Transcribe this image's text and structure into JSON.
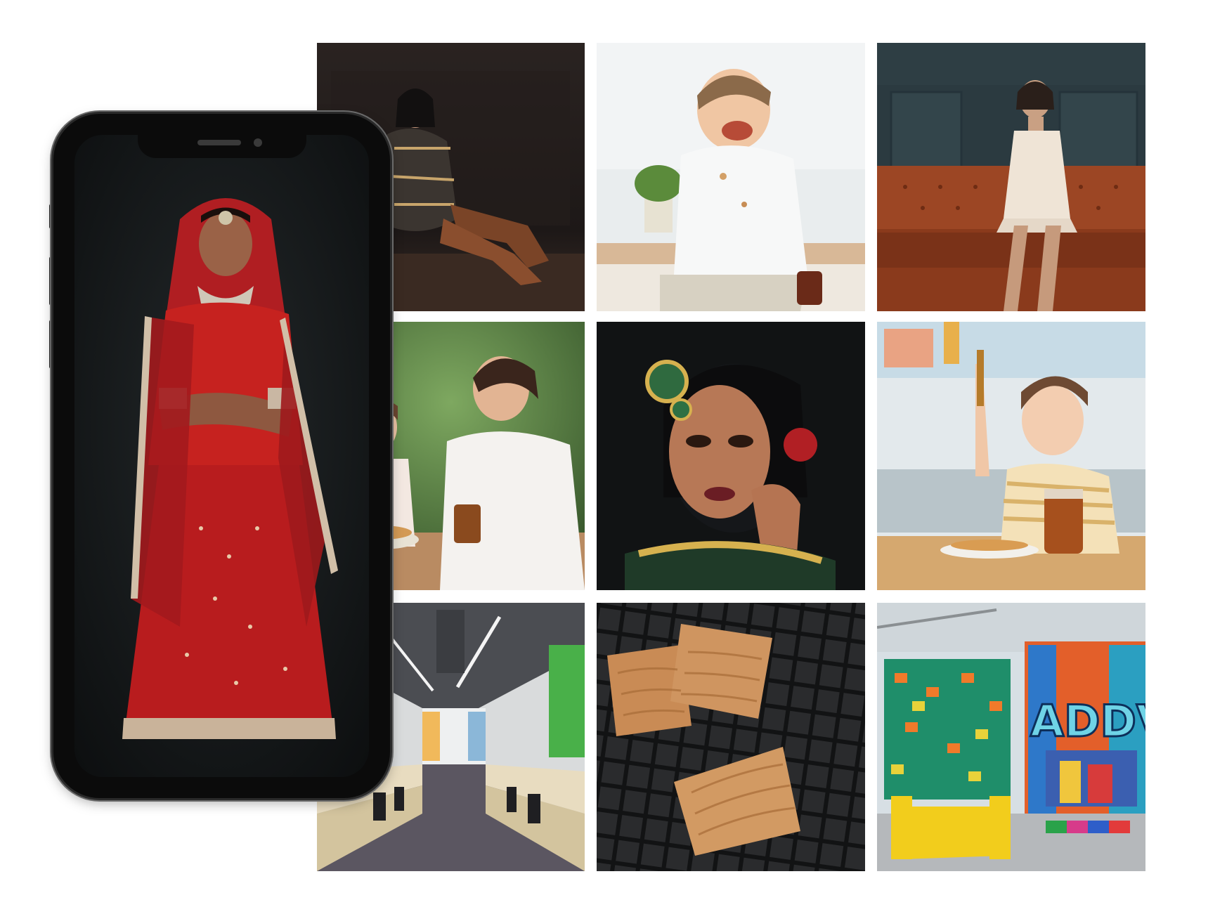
{
  "title": "",
  "colors": {
    "background": "#ffffff",
    "phone_frame": "#0b0b0b"
  },
  "phone": {
    "screen_photo": "woman-red-lehenga-portrait"
  },
  "grid": [
    "woman-posing-brown-boots",
    "smiling-toddler-white-shirt",
    "woman-on-leather-sofa",
    "mother-daughter-breakfast",
    "bridal-makeup-portrait",
    "girl-honey-dipper",
    "modern-office-workspace",
    "baked-biscuits-on-rack",
    "colorful-graffiti-office"
  ]
}
